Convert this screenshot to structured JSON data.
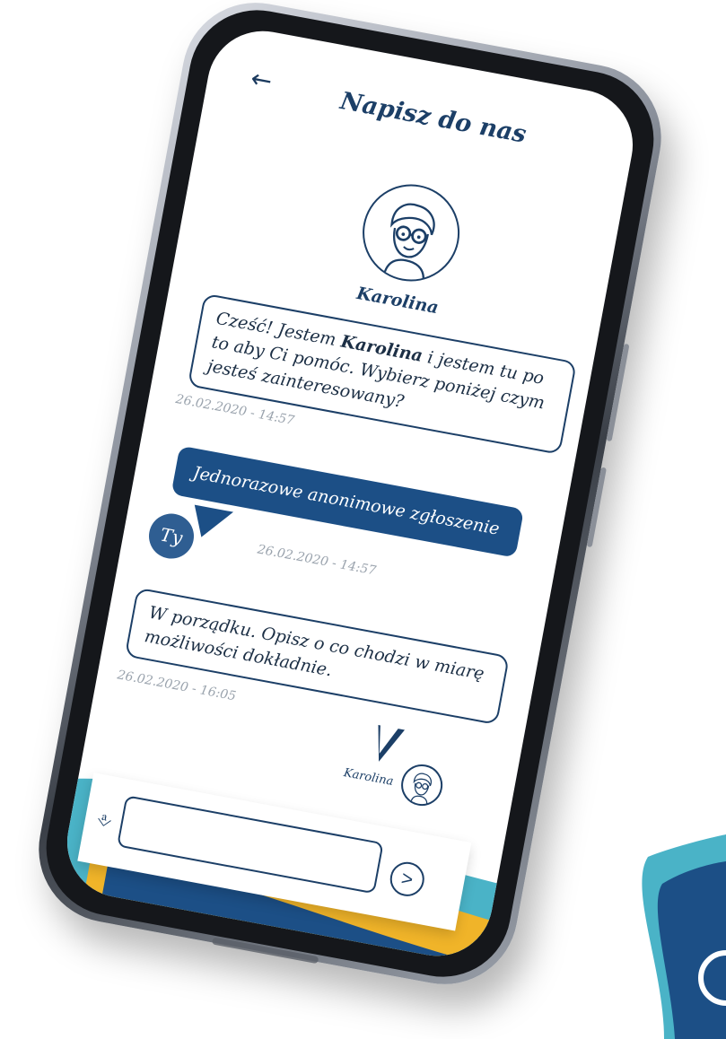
{
  "header": {
    "back_icon": "arrow-left-icon",
    "title": "Napisz do nas"
  },
  "agent": {
    "name": "Karolina",
    "label_small": "Karolina"
  },
  "messages": [
    {
      "sender": "agent",
      "text_before": "Cześć! Jestem ",
      "text_bold": "Karolina",
      "text_after": " i jestem tu po to aby Ci pomóc. Wybierz poniżej czym jesteś zainteresowany?",
      "timestamp": "26.02.2020 - 14:57"
    },
    {
      "sender": "user",
      "avatar_label": "Ty",
      "text": "Jednorazowe anonimowe zgłoszenie",
      "timestamp": "26.02.2020 - 14:57"
    },
    {
      "sender": "agent",
      "text": "W porządku. Opisz o co chodzi w miarę możliwości dokładnie.",
      "timestamp": "26.02.2020 - 16:05"
    }
  ],
  "composer": {
    "placeholder": "",
    "attach_icon": "paperclip-icon",
    "send_icon": "send-arrow-icon"
  },
  "colors": {
    "primary": "#1c3f67",
    "bubble_user": "#1c4f86",
    "accent_teal": "#4ab3c7",
    "accent_yellow": "#f0b429",
    "timestamp": "#9aa3ad"
  }
}
